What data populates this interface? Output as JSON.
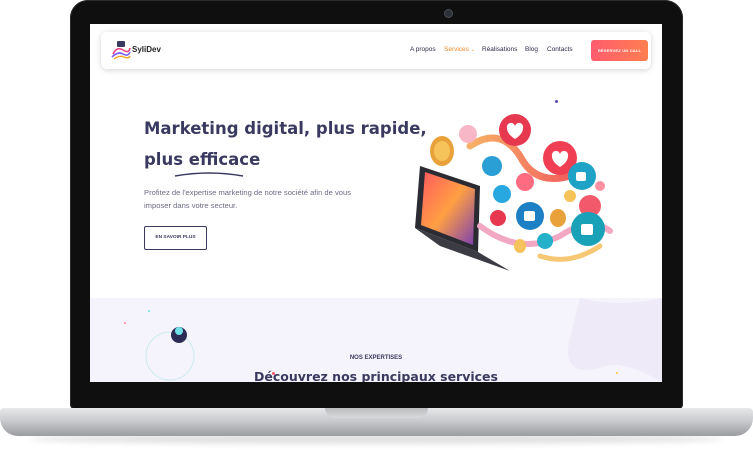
{
  "brand": {
    "name": "SyliDev"
  },
  "nav": {
    "items": [
      {
        "label": "A propos",
        "active": false
      },
      {
        "label": "Services",
        "active": true,
        "has_dropdown": true
      },
      {
        "label": "Réalisations",
        "active": false
      },
      {
        "label": "Blog",
        "active": false
      },
      {
        "label": "Contacts",
        "active": false
      }
    ],
    "dropdown_icon": "chevron-down-icon",
    "cta_label": "RÉSERVEZ UN CALL"
  },
  "hero": {
    "title_line1": "Marketing digital, plus rapide,",
    "title_line2": "plus efficace",
    "description": "Profitez de l'expertise marketing de notre société afin de vous imposer dans votre secteur.",
    "button_label": "EN SAVOIR PLUS"
  },
  "services_section": {
    "kicker": "NOS EXPERTISES",
    "title": "Découvrez nos principaux services"
  },
  "colors": {
    "primary_text": "#3a3a60",
    "accent_orange": "#f08a2c",
    "cta_gradient_start": "#ff5b6e",
    "cta_gradient_end": "#ff7f50",
    "section_bg": "#f5f4fc"
  }
}
